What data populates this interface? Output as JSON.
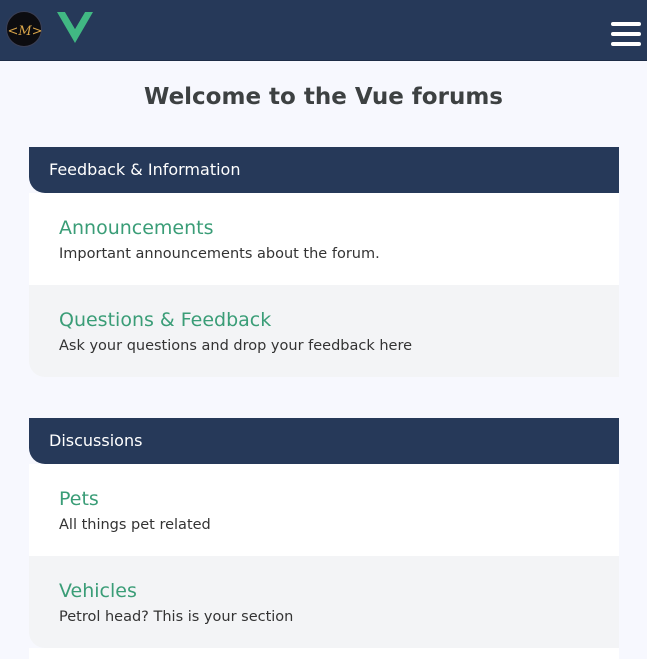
{
  "header": {
    "site_logo_text": "<M>",
    "vue_logo": "vue-logo-icon",
    "menu_icon": "hamburger-menu-icon"
  },
  "page": {
    "title": "Welcome to the Vue forums"
  },
  "categories": [
    {
      "name": "Feedback & Information",
      "forums": [
        {
          "title": "Announcements",
          "description": "Important announcements about the forum."
        },
        {
          "title": "Questions & Feedback",
          "description": "Ask your questions and drop your feedback here"
        }
      ]
    },
    {
      "name": "Discussions",
      "forums": [
        {
          "title": "Pets",
          "description": "All things pet related"
        },
        {
          "title": "Vehicles",
          "description": "Petrol head? This is your section"
        }
      ]
    }
  ],
  "colors": {
    "navbar": "#263959",
    "accent_green": "#3a9d77",
    "page_background": "#f7f8fe",
    "title_text": "#3d4142"
  }
}
